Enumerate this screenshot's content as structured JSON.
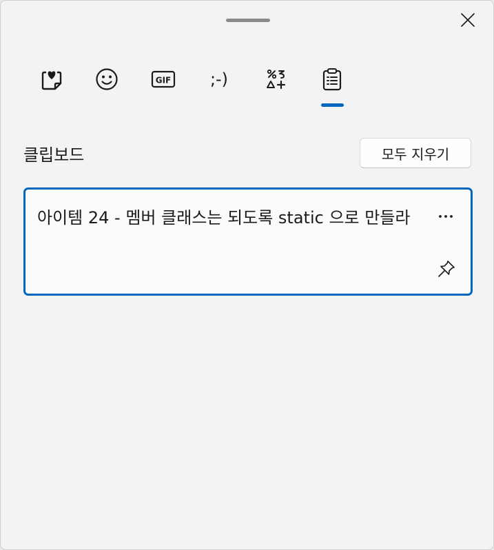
{
  "window": {
    "close_icon": "close-icon"
  },
  "tabs": [
    {
      "name": "recently-used",
      "icon": "heart-sticky-icon"
    },
    {
      "name": "emoji",
      "icon": "smiley-icon"
    },
    {
      "name": "gif",
      "icon": "gif-icon",
      "label": "GIF"
    },
    {
      "name": "kaomoji",
      "icon": "kaomoji-icon",
      "label": ";-)"
    },
    {
      "name": "symbols",
      "icon": "symbols-icon"
    },
    {
      "name": "clipboard",
      "icon": "clipboard-icon",
      "selected": true
    }
  ],
  "clipboard": {
    "title": "클립보드",
    "clear_all_label": "모두 지우기",
    "items": [
      {
        "text": "아이템 24 - 멤버 클래스는 되도록 static 으로 만들라",
        "more_icon": "more-icon",
        "pin_icon": "pin-icon"
      }
    ]
  },
  "colors": {
    "accent": "#0067c0",
    "background": "#f3f3f3"
  }
}
